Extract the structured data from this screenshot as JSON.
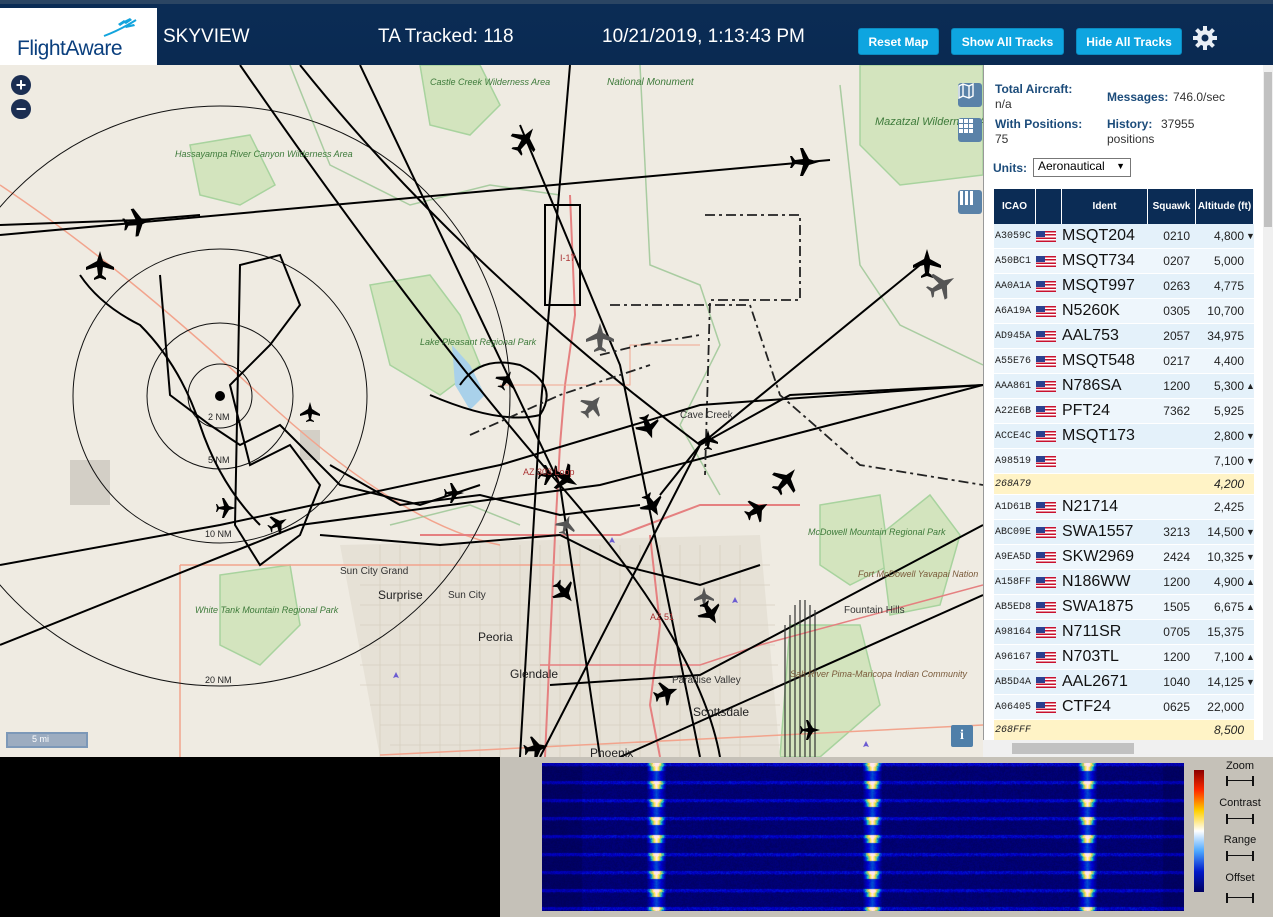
{
  "header": {
    "logo_text": "FlightAware",
    "app_title": "SKYVIEW",
    "tracked": "TA Tracked: 118",
    "datetime": "10/21/2019, 1:13:43 PM",
    "reset_map": "Reset Map",
    "show_all": "Show All Tracks",
    "hide_all": "Hide All Tracks"
  },
  "map": {
    "zoom_in": "+",
    "zoom_out": "−",
    "info": "i",
    "scale_text": "5 mi",
    "range_rings": [
      "2 NM",
      "5 NM",
      "10 NM",
      "20 NM"
    ],
    "places": [
      {
        "t": "Castle Creek Wilderness Area"
      },
      {
        "t": "National Monument"
      },
      {
        "t": "Hassayampa River Canyon Wilderness Area"
      },
      {
        "t": "Mazatzal Wilderness Area"
      },
      {
        "t": "I-17"
      },
      {
        "t": "Lake Pleasant Regional Park"
      },
      {
        "t": "Cave Creek"
      },
      {
        "t": "AZ 303 Loop"
      },
      {
        "t": "McDowell Mountain Regional Park"
      },
      {
        "t": "Fort McDowell Yavapai Nation"
      },
      {
        "t": "Sun City Grand"
      },
      {
        "t": "Surprise"
      },
      {
        "t": "Sun City"
      },
      {
        "t": "White Tank Mountain Regional Park"
      },
      {
        "t": "Peoria"
      },
      {
        "t": "AZ 51"
      },
      {
        "t": "Fountain Hills"
      },
      {
        "t": "Glendale"
      },
      {
        "t": "Paradise Valley"
      },
      {
        "t": "Scottsdale"
      },
      {
        "t": "Phoenix"
      },
      {
        "t": "Salt River Pima-Maricopa Indian Community"
      }
    ]
  },
  "sidebar": {
    "total_label": "Total Aircraft:",
    "total_value": "n/a",
    "messages_label": "Messages:",
    "messages_value": "746.0/sec",
    "positions_label": "With Positions:",
    "positions_value": "75",
    "history_label": "History:",
    "history_value": "37955",
    "history_unit": "positions",
    "units_label": "Units:",
    "units_value": "Aeronautical",
    "columns": [
      "ICAO",
      "Ident",
      "Squawk",
      "Altitude (ft)"
    ],
    "rows": [
      {
        "icao": "A3059C",
        "flag": true,
        "ident": "MSQT204",
        "squawk": "0210",
        "alt": "4,800",
        "trend": "▼"
      },
      {
        "icao": "A50BC1",
        "flag": true,
        "ident": "MSQT734",
        "squawk": "0207",
        "alt": "5,000",
        "trend": ""
      },
      {
        "icao": "AA0A1A",
        "flag": true,
        "ident": "MSQT997",
        "squawk": "0263",
        "alt": "4,775",
        "trend": ""
      },
      {
        "icao": "A6A19A",
        "flag": true,
        "ident": "N5260K",
        "squawk": "0305",
        "alt": "10,700",
        "trend": ""
      },
      {
        "icao": "AD945A",
        "flag": true,
        "ident": "AAL753",
        "squawk": "2057",
        "alt": "34,975",
        "trend": ""
      },
      {
        "icao": "A55E76",
        "flag": true,
        "ident": "MSQT548",
        "squawk": "0217",
        "alt": "4,400",
        "trend": ""
      },
      {
        "icao": "AAA861",
        "flag": true,
        "ident": "N786SA",
        "squawk": "1200",
        "alt": "5,300",
        "trend": "▲"
      },
      {
        "icao": "A22E6B",
        "flag": true,
        "ident": "PFT24",
        "squawk": "7362",
        "alt": "5,925",
        "trend": ""
      },
      {
        "icao": "ACCE4C",
        "flag": true,
        "ident": "MSQT173",
        "squawk": "",
        "alt": "2,800",
        "trend": "▼"
      },
      {
        "icao": "A98519",
        "flag": true,
        "ident": "",
        "squawk": "",
        "alt": "7,100",
        "trend": "▼"
      },
      {
        "icao": "268A79",
        "flag": false,
        "ident": "",
        "squawk": "",
        "alt": "4,200",
        "trend": "",
        "hl": true
      },
      {
        "icao": "A1D61B",
        "flag": true,
        "ident": "N21714",
        "squawk": "",
        "alt": "2,425",
        "trend": ""
      },
      {
        "icao": "ABC09E",
        "flag": true,
        "ident": "SWA1557",
        "squawk": "3213",
        "alt": "14,500",
        "trend": "▼"
      },
      {
        "icao": "A9EA5D",
        "flag": true,
        "ident": "SKW2969",
        "squawk": "2424",
        "alt": "10,325",
        "trend": "▼"
      },
      {
        "icao": "A158FF",
        "flag": true,
        "ident": "N186WW",
        "squawk": "1200",
        "alt": "4,900",
        "trend": "▲"
      },
      {
        "icao": "AB5ED8",
        "flag": true,
        "ident": "SWA1875",
        "squawk": "1505",
        "alt": "6,675",
        "trend": "▲"
      },
      {
        "icao": "A98164",
        "flag": true,
        "ident": "N711SR",
        "squawk": "0705",
        "alt": "15,375",
        "trend": ""
      },
      {
        "icao": "A96167",
        "flag": true,
        "ident": "N703TL",
        "squawk": "1200",
        "alt": "7,100",
        "trend": "▲"
      },
      {
        "icao": "AB5D4A",
        "flag": true,
        "ident": "AAL2671",
        "squawk": "1040",
        "alt": "14,125",
        "trend": "▼"
      },
      {
        "icao": "A06405",
        "flag": true,
        "ident": "CTF24",
        "squawk": "0625",
        "alt": "22,000",
        "trend": ""
      },
      {
        "icao": "268FFF",
        "flag": false,
        "ident": "",
        "squawk": "",
        "alt": "8,500",
        "trend": "",
        "hl": true
      }
    ]
  },
  "waterfall": {
    "zoom": "Zoom",
    "contrast": "Contrast",
    "range": "Range",
    "offset": "Offset"
  },
  "colors": {
    "header_bg": "#0b2c55",
    "button": "#0ea5e0",
    "track": "#000000",
    "map_bg": "#efebe2",
    "park": "#c9dfb0",
    "urban": "#e0dcd2"
  }
}
